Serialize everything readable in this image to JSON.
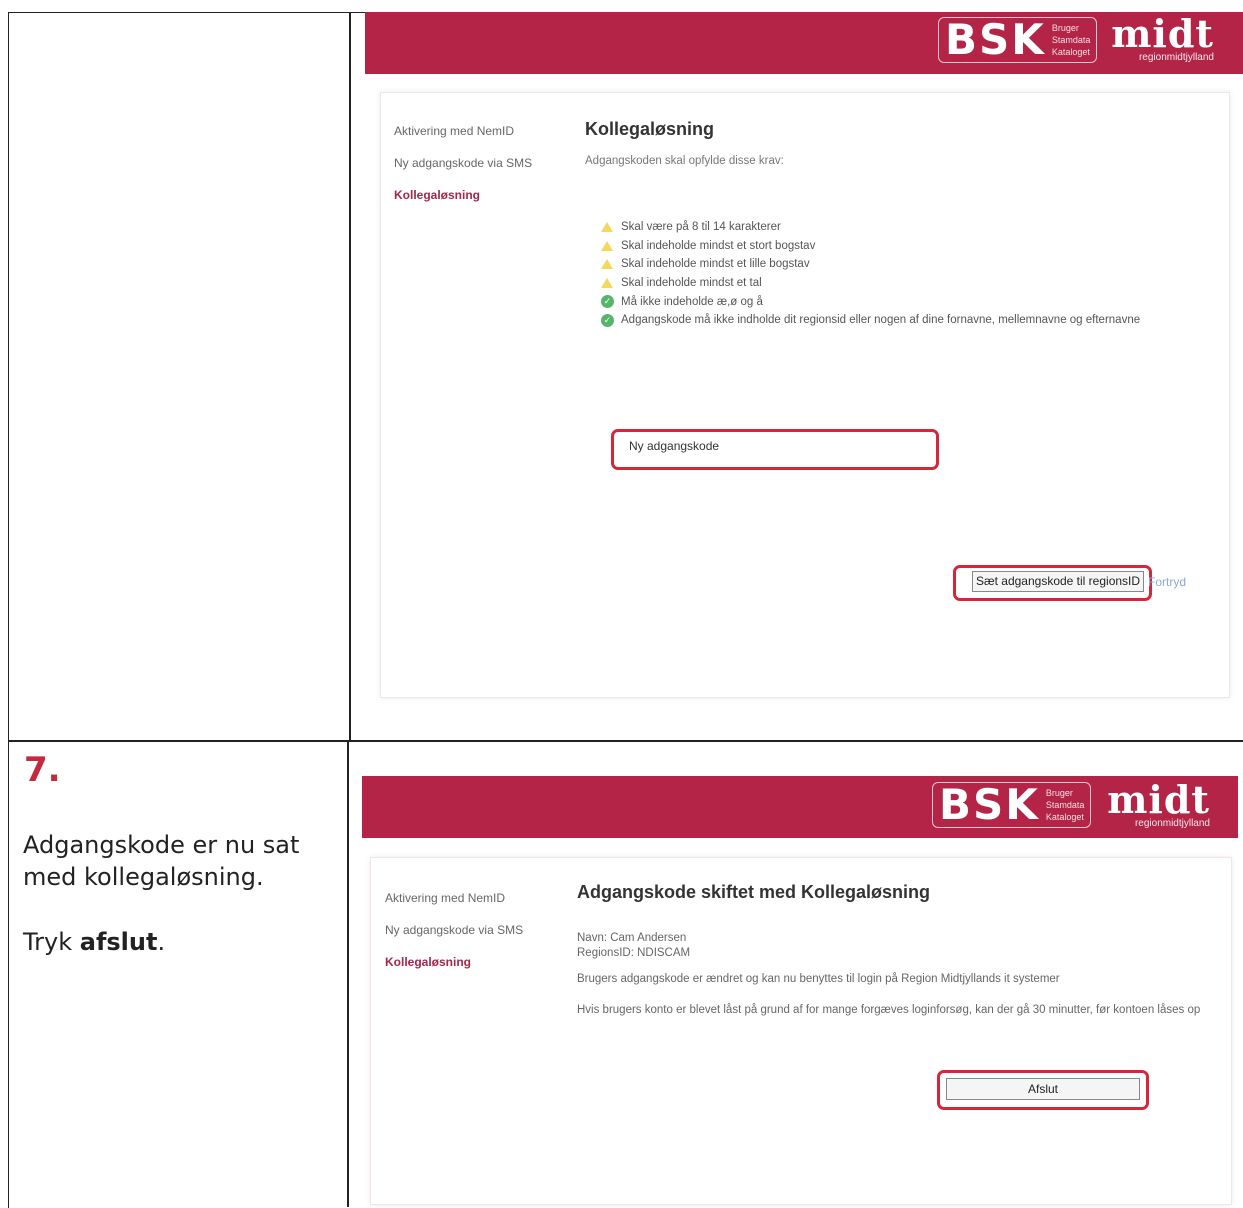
{
  "screen1": {
    "logo_bsk": "BSK",
    "logo_bsk_sub": [
      "Bruger",
      "Stamdata",
      "Kataloget"
    ],
    "logo_midt": "midt",
    "logo_midt_sub": "regionmidtjylland",
    "nav": [
      "Aktivering med NemID",
      "Ny adgangskode via SMS",
      "Kollegaløsning"
    ],
    "title": "Kollegaløsning",
    "subtitle": "Adgangskoden skal opfylde disse krav:",
    "requirements": [
      {
        "text": "Skal være på 8 til 14 karakterer",
        "status": "warn"
      },
      {
        "text": "Skal indeholde mindst et stort bogstav",
        "status": "warn"
      },
      {
        "text": "Skal indeholde mindst et lille bogstav",
        "status": "warn"
      },
      {
        "text": "Skal indeholde mindst et tal",
        "status": "warn"
      },
      {
        "text": "Må ikke indeholde æ,ø og å",
        "status": "ok"
      },
      {
        "text": "Adgangskode må ikke indholde dit regionsid eller nogen af dine fornavne, mellemnavne og efternavne",
        "status": "ok"
      }
    ],
    "new_password_label": "Ny adgangskode",
    "set_button": "Sæt adgangskode til regionsID",
    "cancel_link": "Fortryd"
  },
  "step": {
    "number": "7.",
    "line1": "Adgangskode er nu sat",
    "line2": "med kollegaløsning.",
    "tryk": "Tryk",
    "afslut_bold": "afslut",
    "period": "."
  },
  "screen2": {
    "logo_bsk": "BSK",
    "logo_bsk_sub": [
      "Bruger",
      "Stamdata",
      "Kataloget"
    ],
    "logo_midt": "midt",
    "logo_midt_sub": "regionmidtjylland",
    "nav": [
      "Aktivering med NemID",
      "Ny adgangskode via SMS",
      "Kollegaløsning"
    ],
    "title": "Adgangskode skiftet med Kollegaløsning",
    "navn": "Navn: Cam Andersen",
    "regionsid": "RegionsID: NDISCAM",
    "msg1": "Brugers adgangskode er ændret og kan nu benyttes til login på Region Midtjyllands it systemer",
    "msg2": "Hvis brugers konto er blevet låst på grund af for mange forgæves loginforsøg, kan der gå 30 minutter, før kontoen låses op",
    "finish_button": "Afslut"
  },
  "colors": {
    "header": "#b32446",
    "highlight": "#d5263c",
    "active_nav": "#a3284a",
    "step_number": "#c42a3e"
  }
}
